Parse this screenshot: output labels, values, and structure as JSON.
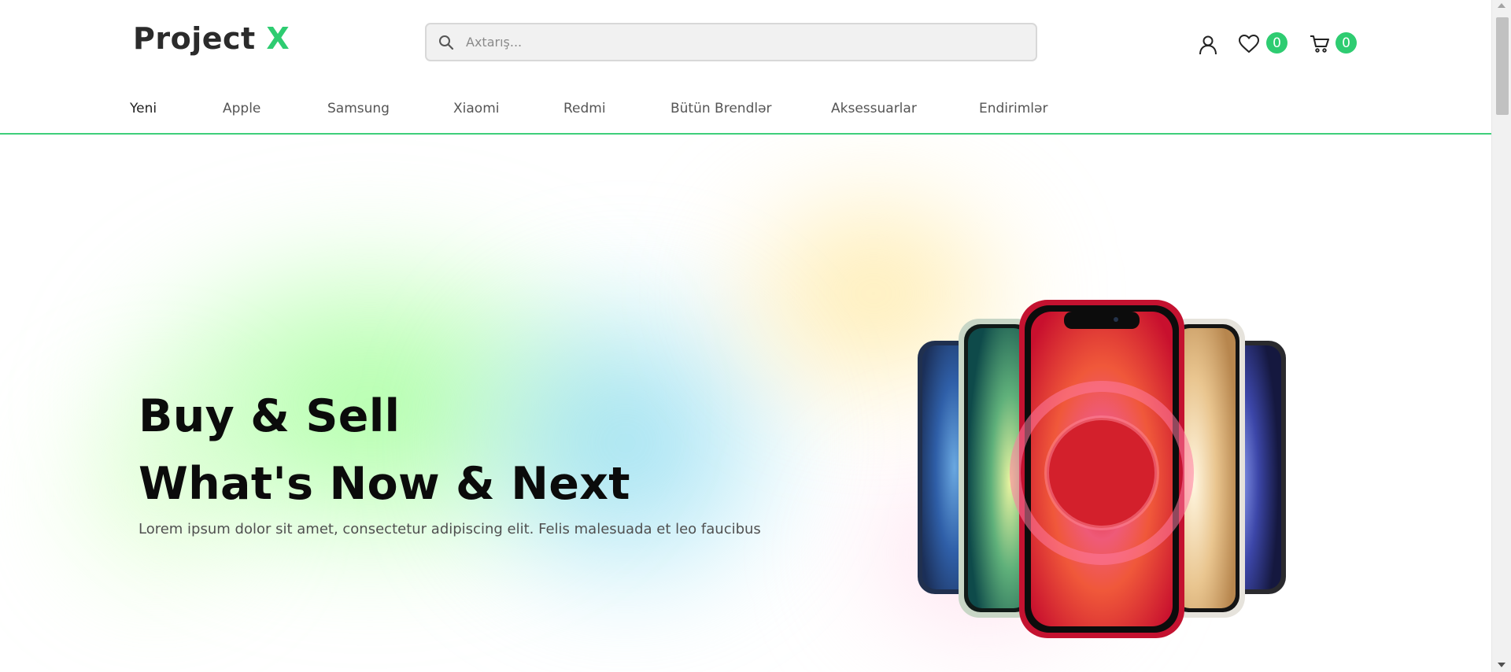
{
  "brand": {
    "name": "Project",
    "accent": "X",
    "accent_color": "#2ecc71"
  },
  "search": {
    "placeholder": "Axtarış...",
    "value": ""
  },
  "header_icons": {
    "user": "user-icon",
    "wishlist": "heart-icon",
    "cart": "cart-icon",
    "wishlist_count": "0",
    "cart_count": "0"
  },
  "nav": {
    "items": [
      {
        "label": "Yeni"
      },
      {
        "label": "Apple"
      },
      {
        "label": "Samsung"
      },
      {
        "label": "Xiaomi"
      },
      {
        "label": "Redmi"
      },
      {
        "label": "Bütün Brendlər"
      },
      {
        "label": "Aksessuarlar"
      },
      {
        "label": "Endirimlər"
      }
    ]
  },
  "hero": {
    "title_line1": "Buy & Sell",
    "title_line2": "What's Now & Next",
    "subtitle": "Lorem ipsum dolor sit amet, consectetur adipiscing elit. Felis malesuada et leo faucibus"
  },
  "colors": {
    "accent": "#2ecc71",
    "header_border": "#3ecf7a"
  }
}
